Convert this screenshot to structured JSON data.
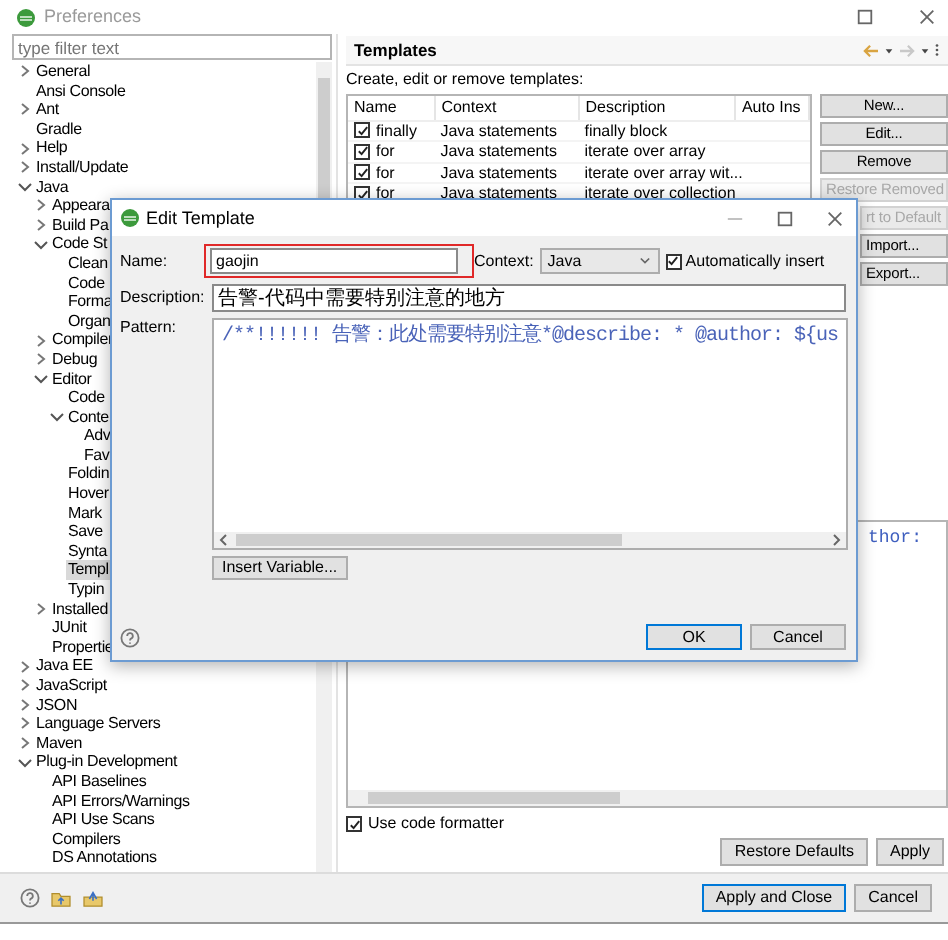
{
  "window": {
    "title": "Preferences"
  },
  "filter": {
    "placeholder": "type filter text"
  },
  "tree": [
    {
      "label": "General",
      "expanded": false,
      "selected": false
    },
    {
      "label": "Ansi Console",
      "selected": false
    },
    {
      "label": "Ant",
      "expanded": false,
      "selected": false
    },
    {
      "label": "Gradle",
      "selected": false
    },
    {
      "label": "Help",
      "expanded": false,
      "selected": false
    },
    {
      "label": "Install/Update",
      "expanded": false,
      "selected": false
    },
    {
      "label": "Java",
      "expanded": true,
      "selected": false,
      "children": [
        {
          "label": "Appeara",
          "expanded": false,
          "selected": false
        },
        {
          "label": "Build Pa",
          "expanded": false,
          "selected": false
        },
        {
          "label": "Code St",
          "expanded": true,
          "selected": false,
          "children": [
            {
              "label": "Clean",
              "selected": false
            },
            {
              "label": "Code",
              "selected": false
            },
            {
              "label": "Forma",
              "selected": false
            },
            {
              "label": "Organ",
              "selected": false
            }
          ]
        },
        {
          "label": "Compiler",
          "expanded": false,
          "selected": false
        },
        {
          "label": "Debug",
          "expanded": false,
          "selected": false
        },
        {
          "label": "Editor",
          "expanded": true,
          "selected": false,
          "children": [
            {
              "label": "Code",
              "selected": false
            },
            {
              "label": "Conte",
              "expanded": true,
              "selected": false,
              "children": [
                {
                  "label": "Adv",
                  "selected": false
                },
                {
                  "label": "Fav",
                  "selected": false
                }
              ]
            },
            {
              "label": "Foldin",
              "selected": false
            },
            {
              "label": "Hover",
              "selected": false
            },
            {
              "label": "Mark",
              "selected": false
            },
            {
              "label": "Save",
              "selected": false
            },
            {
              "label": "Synta",
              "selected": false
            },
            {
              "label": "Templ",
              "selected": true
            },
            {
              "label": "Typin",
              "selected": false
            }
          ]
        },
        {
          "label": "Installed",
          "expanded": false,
          "selected": false
        },
        {
          "label": "JUnit",
          "selected": false
        },
        {
          "label": "Propertie",
          "selected": false
        }
      ]
    },
    {
      "label": "Java EE",
      "expanded": false,
      "selected": false
    },
    {
      "label": "JavaScript",
      "expanded": false,
      "selected": false
    },
    {
      "label": "JSON",
      "expanded": false,
      "selected": false
    },
    {
      "label": "Language Servers",
      "expanded": false,
      "selected": false
    },
    {
      "label": "Maven",
      "expanded": false,
      "selected": false
    },
    {
      "label": "Plug-in Development",
      "expanded": true,
      "selected": false,
      "children": [
        {
          "label": "API Baselines",
          "selected": false
        },
        {
          "label": "API Errors/Warnings",
          "selected": false
        },
        {
          "label": "API Use Scans",
          "selected": false
        },
        {
          "label": "Compilers",
          "selected": false
        },
        {
          "label": "DS Annotations",
          "selected": false
        }
      ]
    }
  ],
  "templates_panel": {
    "title": "Templates",
    "hint": "Create, edit or remove templates:",
    "table": {
      "columns": [
        "Name",
        "Context",
        "Description",
        "Auto Ins"
      ],
      "rows": [
        {
          "checked": true,
          "name": "finally",
          "context": "Java statements",
          "description": "finally block"
        },
        {
          "checked": true,
          "name": "for",
          "context": "Java statements",
          "description": "iterate over array"
        },
        {
          "checked": true,
          "name": "for",
          "context": "Java statements",
          "description": "iterate over array wit..."
        },
        {
          "checked": true,
          "name": "for",
          "context": "Java statements",
          "description": "iterate over collection"
        }
      ]
    },
    "buttons": [
      {
        "label": "New...",
        "disabled": false
      },
      {
        "label": "Edit...",
        "disabled": false
      },
      {
        "label": "Remove",
        "disabled": false
      },
      {
        "label": "Restore Removed",
        "disabled": true
      },
      {
        "label": "rt to Default",
        "disabled": true,
        "partly_hidden": true
      },
      {
        "label": "Import...",
        "disabled": false,
        "partly_hidden": true
      },
      {
        "label": "Export...",
        "disabled": false,
        "partly_hidden": true
      }
    ],
    "preview": {
      "code": "thor:"
    },
    "use_code_formatter": {
      "label": "Use code formatter",
      "checked": true
    },
    "actions": [
      "Restore Defaults",
      "Apply"
    ]
  },
  "footer_buttons": [
    {
      "label": "Apply and Close",
      "default": true
    },
    {
      "label": "Cancel",
      "default": false
    }
  ],
  "dialog": {
    "title": "Edit Template",
    "name_label": "Name:",
    "name_value": "gaojin",
    "context_label": "Context:",
    "context_value": "Java",
    "auto_insert": {
      "label": "Automatically insert",
      "checked": true
    },
    "description_label": "Description:",
    "description_value": "告警-代码中需要特别注意的地方",
    "pattern_label": "Pattern:",
    "pattern": "/**!!!!!! 告警：此处需要特别注意*@describe: * @author: ${us",
    "insert_variable": "Insert Variable...",
    "buttons": [
      {
        "label": "OK",
        "default": true
      },
      {
        "label": "Cancel",
        "default": false
      }
    ]
  }
}
